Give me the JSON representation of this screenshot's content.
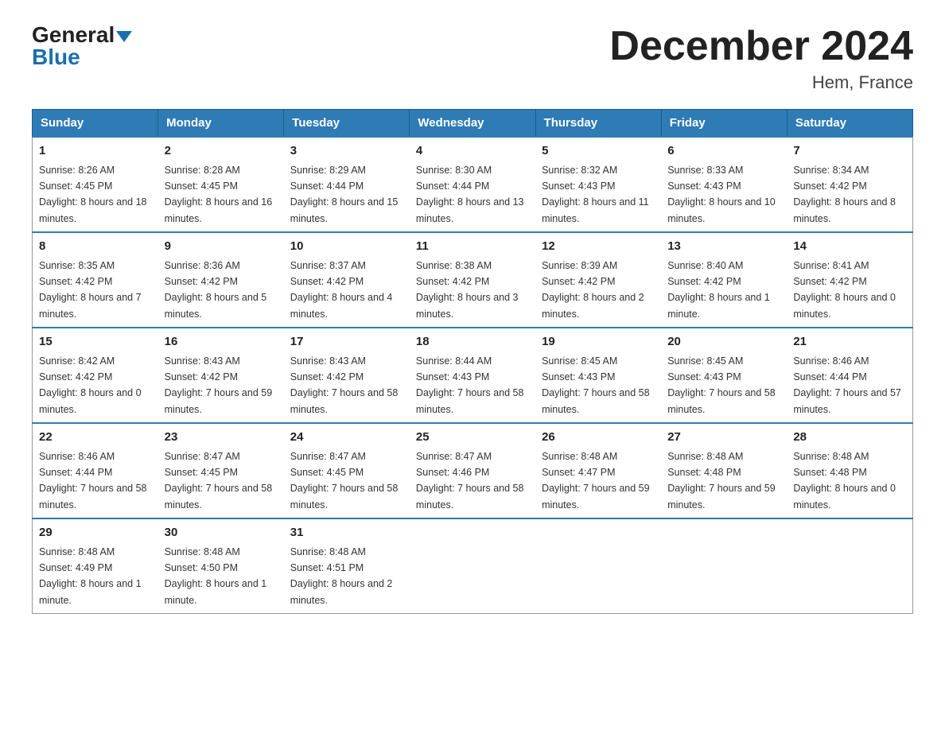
{
  "header": {
    "logo_general": "General",
    "logo_blue": "Blue",
    "title": "December 2024",
    "subtitle": "Hem, France"
  },
  "days_of_week": [
    "Sunday",
    "Monday",
    "Tuesday",
    "Wednesday",
    "Thursday",
    "Friday",
    "Saturday"
  ],
  "weeks": [
    [
      {
        "day": "1",
        "sunrise": "8:26 AM",
        "sunset": "4:45 PM",
        "daylight": "8 hours and 18 minutes."
      },
      {
        "day": "2",
        "sunrise": "8:28 AM",
        "sunset": "4:45 PM",
        "daylight": "8 hours and 16 minutes."
      },
      {
        "day": "3",
        "sunrise": "8:29 AM",
        "sunset": "4:44 PM",
        "daylight": "8 hours and 15 minutes."
      },
      {
        "day": "4",
        "sunrise": "8:30 AM",
        "sunset": "4:44 PM",
        "daylight": "8 hours and 13 minutes."
      },
      {
        "day": "5",
        "sunrise": "8:32 AM",
        "sunset": "4:43 PM",
        "daylight": "8 hours and 11 minutes."
      },
      {
        "day": "6",
        "sunrise": "8:33 AM",
        "sunset": "4:43 PM",
        "daylight": "8 hours and 10 minutes."
      },
      {
        "day": "7",
        "sunrise": "8:34 AM",
        "sunset": "4:42 PM",
        "daylight": "8 hours and 8 minutes."
      }
    ],
    [
      {
        "day": "8",
        "sunrise": "8:35 AM",
        "sunset": "4:42 PM",
        "daylight": "8 hours and 7 minutes."
      },
      {
        "day": "9",
        "sunrise": "8:36 AM",
        "sunset": "4:42 PM",
        "daylight": "8 hours and 5 minutes."
      },
      {
        "day": "10",
        "sunrise": "8:37 AM",
        "sunset": "4:42 PM",
        "daylight": "8 hours and 4 minutes."
      },
      {
        "day": "11",
        "sunrise": "8:38 AM",
        "sunset": "4:42 PM",
        "daylight": "8 hours and 3 minutes."
      },
      {
        "day": "12",
        "sunrise": "8:39 AM",
        "sunset": "4:42 PM",
        "daylight": "8 hours and 2 minutes."
      },
      {
        "day": "13",
        "sunrise": "8:40 AM",
        "sunset": "4:42 PM",
        "daylight": "8 hours and 1 minute."
      },
      {
        "day": "14",
        "sunrise": "8:41 AM",
        "sunset": "4:42 PM",
        "daylight": "8 hours and 0 minutes."
      }
    ],
    [
      {
        "day": "15",
        "sunrise": "8:42 AM",
        "sunset": "4:42 PM",
        "daylight": "8 hours and 0 minutes."
      },
      {
        "day": "16",
        "sunrise": "8:43 AM",
        "sunset": "4:42 PM",
        "daylight": "7 hours and 59 minutes."
      },
      {
        "day": "17",
        "sunrise": "8:43 AM",
        "sunset": "4:42 PM",
        "daylight": "7 hours and 58 minutes."
      },
      {
        "day": "18",
        "sunrise": "8:44 AM",
        "sunset": "4:43 PM",
        "daylight": "7 hours and 58 minutes."
      },
      {
        "day": "19",
        "sunrise": "8:45 AM",
        "sunset": "4:43 PM",
        "daylight": "7 hours and 58 minutes."
      },
      {
        "day": "20",
        "sunrise": "8:45 AM",
        "sunset": "4:43 PM",
        "daylight": "7 hours and 58 minutes."
      },
      {
        "day": "21",
        "sunrise": "8:46 AM",
        "sunset": "4:44 PM",
        "daylight": "7 hours and 57 minutes."
      }
    ],
    [
      {
        "day": "22",
        "sunrise": "8:46 AM",
        "sunset": "4:44 PM",
        "daylight": "7 hours and 58 minutes."
      },
      {
        "day": "23",
        "sunrise": "8:47 AM",
        "sunset": "4:45 PM",
        "daylight": "7 hours and 58 minutes."
      },
      {
        "day": "24",
        "sunrise": "8:47 AM",
        "sunset": "4:45 PM",
        "daylight": "7 hours and 58 minutes."
      },
      {
        "day": "25",
        "sunrise": "8:47 AM",
        "sunset": "4:46 PM",
        "daylight": "7 hours and 58 minutes."
      },
      {
        "day": "26",
        "sunrise": "8:48 AM",
        "sunset": "4:47 PM",
        "daylight": "7 hours and 59 minutes."
      },
      {
        "day": "27",
        "sunrise": "8:48 AM",
        "sunset": "4:48 PM",
        "daylight": "7 hours and 59 minutes."
      },
      {
        "day": "28",
        "sunrise": "8:48 AM",
        "sunset": "4:48 PM",
        "daylight": "8 hours and 0 minutes."
      }
    ],
    [
      {
        "day": "29",
        "sunrise": "8:48 AM",
        "sunset": "4:49 PM",
        "daylight": "8 hours and 1 minute."
      },
      {
        "day": "30",
        "sunrise": "8:48 AM",
        "sunset": "4:50 PM",
        "daylight": "8 hours and 1 minute."
      },
      {
        "day": "31",
        "sunrise": "8:48 AM",
        "sunset": "4:51 PM",
        "daylight": "8 hours and 2 minutes."
      },
      null,
      null,
      null,
      null
    ]
  ],
  "labels": {
    "sunrise_prefix": "Sunrise: ",
    "sunset_prefix": "Sunset: ",
    "daylight_prefix": "Daylight: "
  }
}
